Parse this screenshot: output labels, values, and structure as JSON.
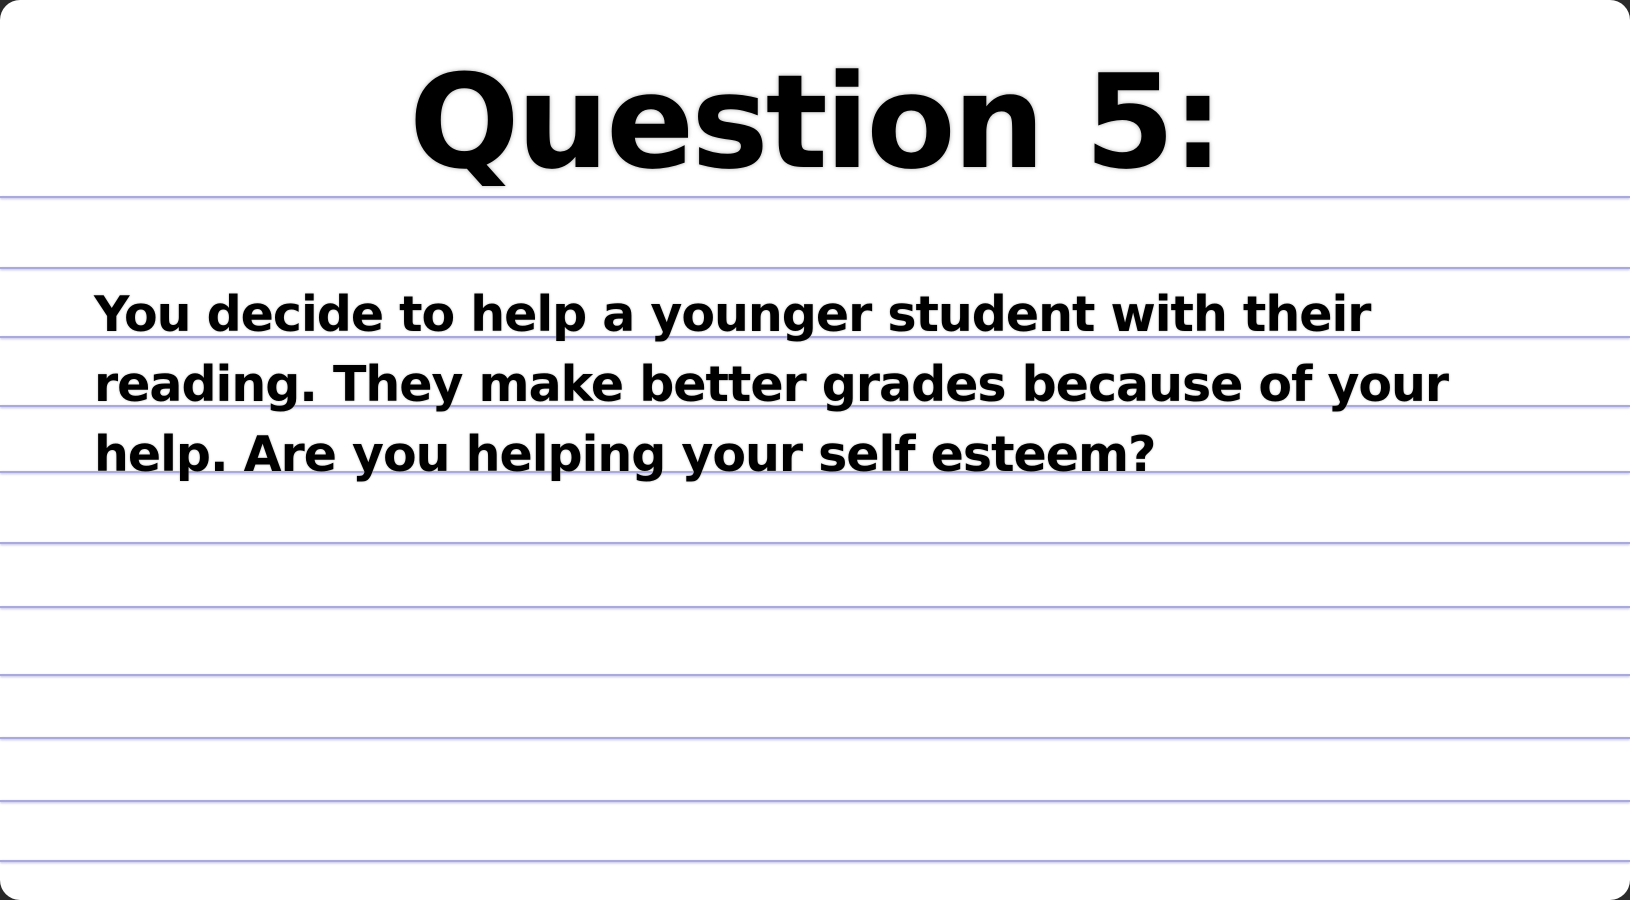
{
  "slide": {
    "title": "Question 5:",
    "question_text": "You decide to help a younger student with their reading. They make better grades because of your help. Are you helping your self esteem?"
  },
  "colors": {
    "background": "#ffffff",
    "rule_line": "#a9a9dc",
    "text": "#000000"
  }
}
